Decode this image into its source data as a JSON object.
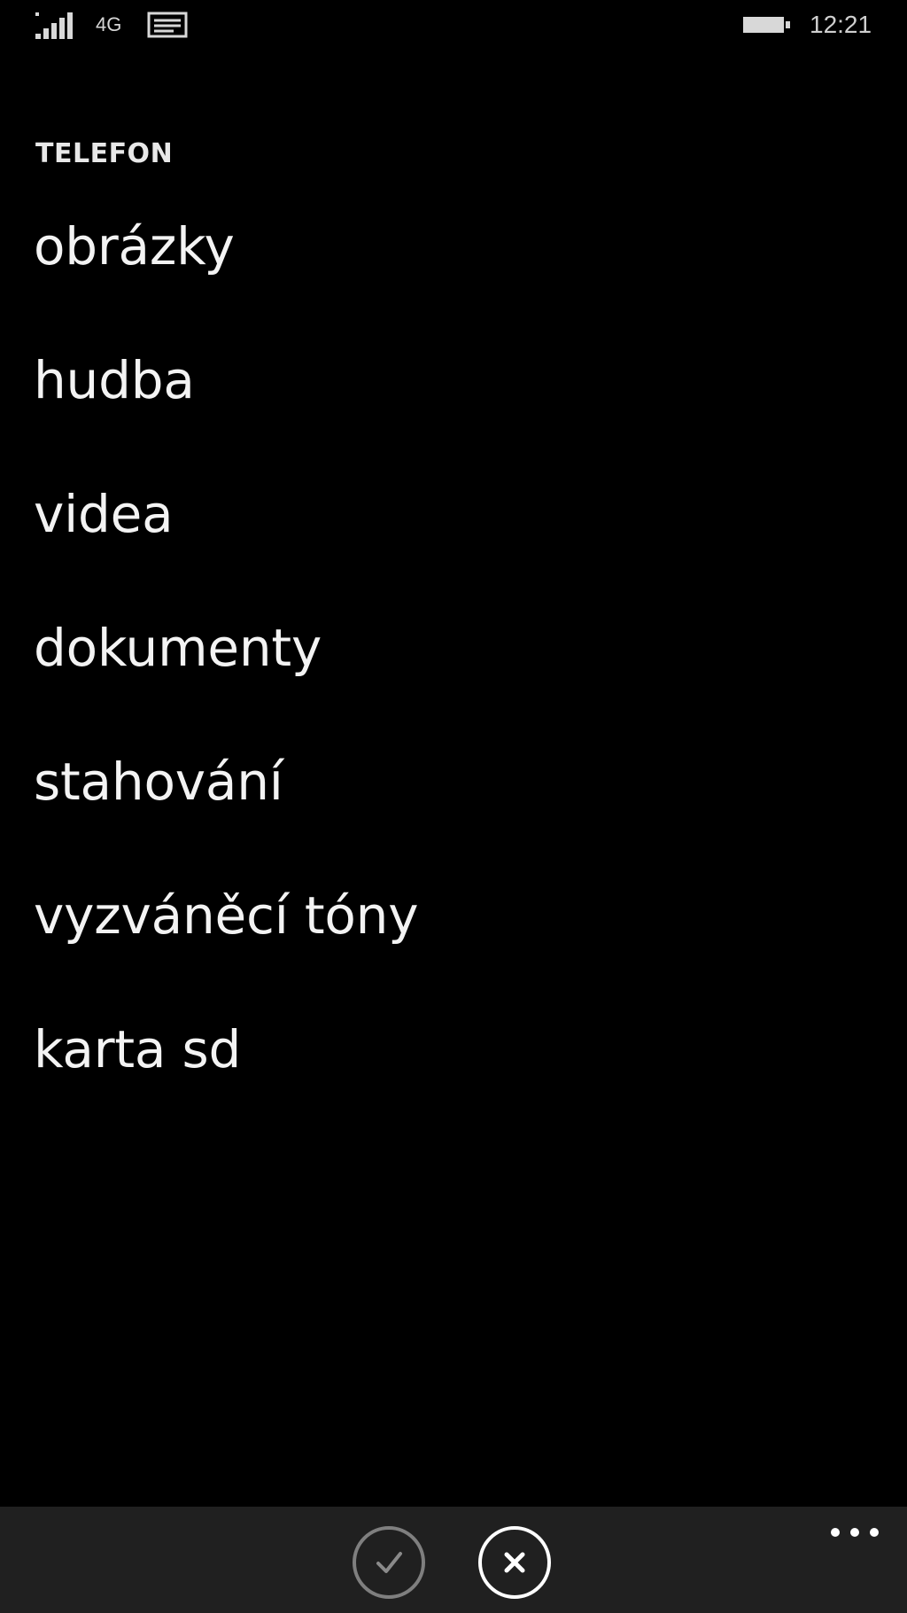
{
  "status_bar": {
    "network": "4G",
    "time": "12:21",
    "icons": [
      "signal-icon",
      "message-icon",
      "battery-icon"
    ]
  },
  "header": {
    "title": "TELEFON"
  },
  "folders": [
    {
      "label": "obrázky"
    },
    {
      "label": "hudba"
    },
    {
      "label": "videa"
    },
    {
      "label": "dokumenty"
    },
    {
      "label": "stahování"
    },
    {
      "label": "vyzváněcí tóny"
    },
    {
      "label": "karta sd"
    }
  ],
  "app_bar": {
    "buttons": [
      {
        "icon": "check-icon",
        "state": "disabled"
      },
      {
        "icon": "close-icon",
        "state": "enabled"
      }
    ],
    "more_icon": "ellipsis-icon"
  },
  "colors": {
    "background": "#000000",
    "app_bar": "#202020",
    "text": "#f3f3f3",
    "disabled": "#7f7f7f"
  }
}
